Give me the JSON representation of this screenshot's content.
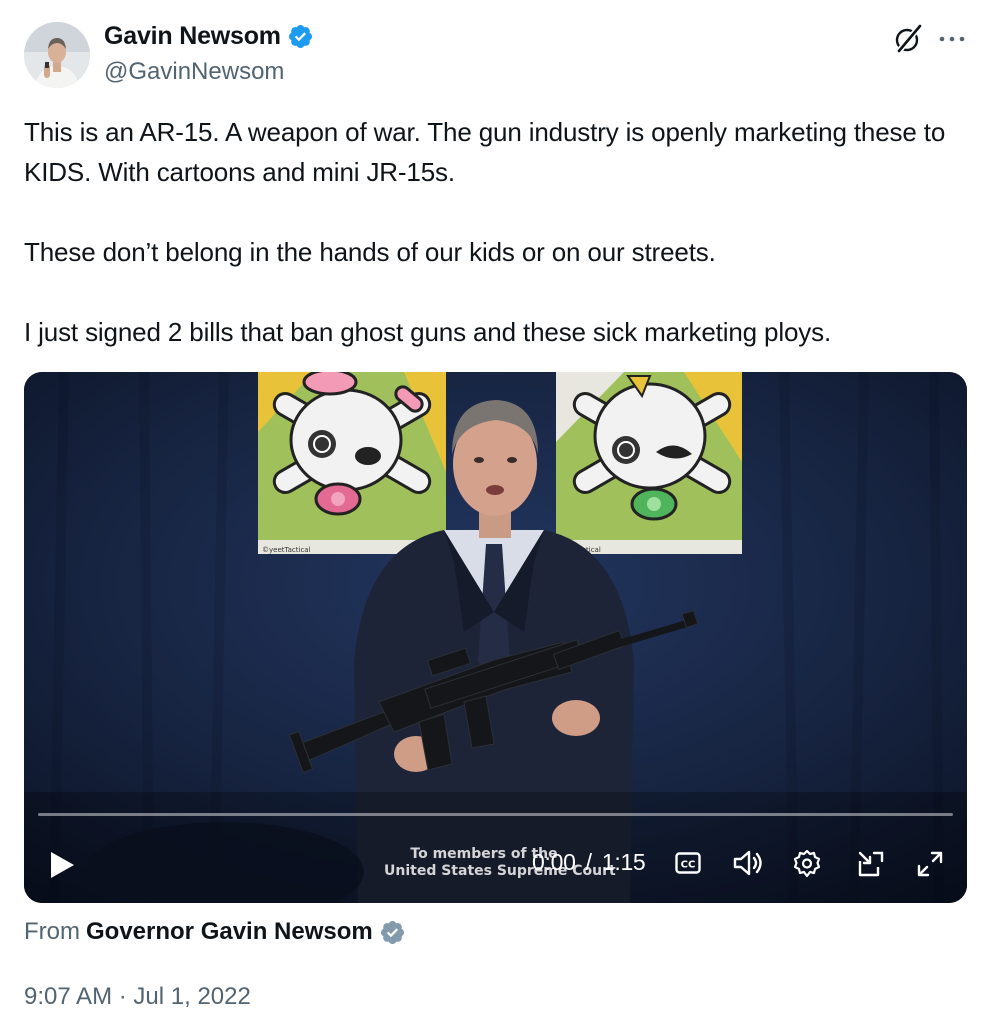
{
  "author": {
    "display_name": "Gavin Newsom",
    "handle": "@GavinNewsom",
    "avatar_icon": "profile-photo",
    "verified_icon": "verified-badge-icon",
    "verified_color": "#1d9bf0"
  },
  "header_actions": {
    "grok_icon": "grok-icon",
    "more_icon": "more-options-icon"
  },
  "text": {
    "paragraphs": [
      "This is an AR-15. A weapon of war. The gun industry is openly marketing these to KIDS. With cartoons and mini JR-15s.",
      "These don’t belong in the hands of our kids or on our streets.",
      "I just signed 2 bills that ban ghost guns and these sick marketing ploys."
    ]
  },
  "video": {
    "poster_left_label": "©yeetTactical",
    "poster_right_label": "tTactical",
    "caption_line1": "To members of the",
    "caption_line2": "United States Supreme Court",
    "current_time": "0:00",
    "time_separator": "/",
    "duration": "1:15",
    "progress": 0,
    "controls": [
      "play-icon",
      "closed-captions-icon",
      "volume-icon",
      "settings-icon",
      "picture-in-picture-icon",
      "fullscreen-icon"
    ]
  },
  "source": {
    "from_label": "From",
    "name": "Governor Gavin Newsom",
    "badge_icon": "gray-verified-badge-icon",
    "badge_color": "#829aab"
  },
  "timestamp": {
    "time": "9:07 AM",
    "separator": "·",
    "date": "Jul 1, 2022"
  },
  "colors": {
    "text": "#0f1419",
    "secondary": "#536471",
    "accent": "#1d9bf0"
  }
}
